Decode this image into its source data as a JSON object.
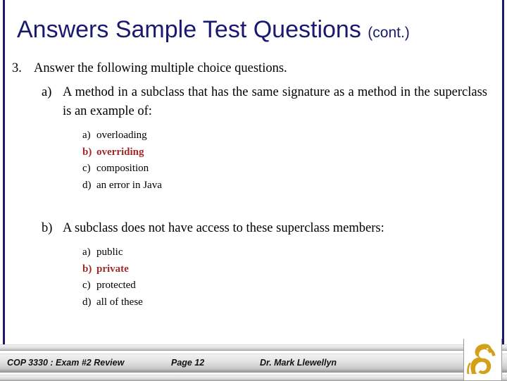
{
  "slide": {
    "title_main": "Answers Sample Test Questions",
    "title_cont": "(cont.)",
    "accent_navy": "#191970",
    "correct_red": "#9E2A2A",
    "logo_gold": "#D4A017"
  },
  "content": {
    "item3": {
      "marker": "3.",
      "text": "Answer the following multiple choice questions."
    },
    "question_a": {
      "marker": "a)",
      "text": "A method in a subclass that has the same signature as a method in the superclass is an example of:",
      "choices": [
        {
          "marker": "a)",
          "text": "overloading",
          "correct": false
        },
        {
          "marker": "b)",
          "text": "overriding",
          "correct": true
        },
        {
          "marker": "c)",
          "text": "composition",
          "correct": false
        },
        {
          "marker": "d)",
          "text": "an error in Java",
          "correct": false
        }
      ]
    },
    "question_b": {
      "marker": "b)",
      "text": "A subclass does not have access to these superclass members:",
      "choices": [
        {
          "marker": "a)",
          "text": "public",
          "correct": false
        },
        {
          "marker": "b)",
          "text": "private",
          "correct": true
        },
        {
          "marker": "c)",
          "text": "protected",
          "correct": false
        },
        {
          "marker": "d)",
          "text": "all of these",
          "correct": false
        }
      ]
    }
  },
  "footer": {
    "course": "COP 3330 : Exam #2 Review",
    "page": "Page 12",
    "author": "Dr. Mark Llewellyn",
    "logo_name": "ucf-pegasus-logo"
  }
}
